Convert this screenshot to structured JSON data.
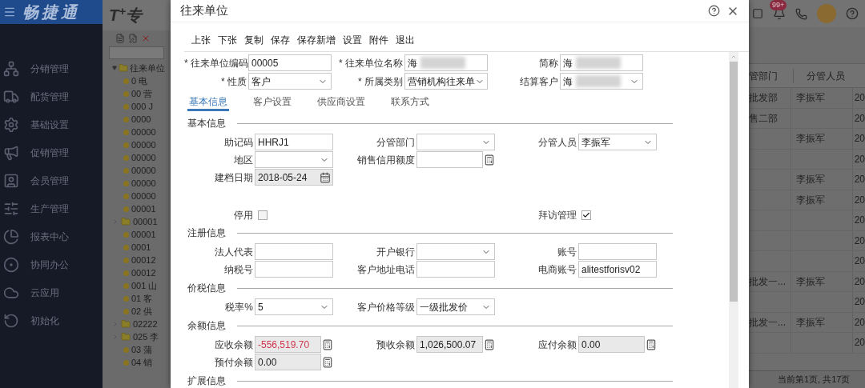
{
  "app": {
    "name": "畅捷通",
    "product": "T$^{+}$专",
    "sidebar": [
      {
        "label": "分销管理"
      },
      {
        "label": "配货管理"
      },
      {
        "label": "基础设置"
      },
      {
        "label": "促销管理"
      },
      {
        "label": "会员管理"
      },
      {
        "label": "生产管理"
      },
      {
        "label": "报表中心"
      },
      {
        "label": "协同办公"
      },
      {
        "label": "云应用"
      },
      {
        "label": "初始化"
      }
    ],
    "tree": {
      "label": "往来单位",
      "expanded": true,
      "children": [
        {
          "kind": "leaf",
          "label": "0 电"
        },
        {
          "kind": "leaf",
          "label": "00 营"
        },
        {
          "kind": "leaf",
          "label": "000 J"
        },
        {
          "kind": "leaf",
          "label": "0000"
        },
        {
          "kind": "leaf",
          "label": "00000"
        },
        {
          "kind": "leaf",
          "label": "00000"
        },
        {
          "kind": "leaf",
          "label": "00000"
        },
        {
          "kind": "leaf",
          "label": "00000"
        },
        {
          "kind": "leaf",
          "label": "00000"
        },
        {
          "kind": "leaf",
          "label": "00000"
        },
        {
          "kind": "leaf",
          "label": "00001"
        },
        {
          "kind": "folder",
          "label": "00001",
          "expanded": false
        },
        {
          "kind": "leaf",
          "label": "00001"
        },
        {
          "kind": "leaf",
          "label": "0001"
        },
        {
          "kind": "leaf",
          "label": "00012"
        },
        {
          "kind": "leaf",
          "label": "00012"
        },
        {
          "kind": "leaf",
          "label": "001 山"
        },
        {
          "kind": "leaf",
          "label": "01 客"
        },
        {
          "kind": "leaf",
          "label": "02 供"
        },
        {
          "kind": "folder",
          "label": "02222",
          "expanded": false
        },
        {
          "kind": "folder",
          "label": "025 李",
          "expanded": false
        },
        {
          "kind": "leaf",
          "label": "03 蒲"
        },
        {
          "kind": "leaf",
          "label": "04 销"
        }
      ]
    },
    "notifications": "99+",
    "table": {
      "columns": [
        "管部门",
        "分管人员"
      ],
      "rows": [
        {
          "dept": "批发部",
          "person": "李振军",
          "column_3": "20"
        },
        {
          "dept": "售二部",
          "person": "",
          "column_3": "20"
        },
        {
          "dept": "",
          "person": "李振军",
          "column_3": "20"
        },
        {
          "dept": "",
          "person": "",
          "column_3": "20"
        },
        {
          "dept": "",
          "person": "李振军",
          "column_3": "20"
        },
        {
          "dept": "",
          "person": "李振军",
          "column_3": "20"
        },
        {
          "dept": "",
          "person": "",
          "column_3": "20"
        },
        {
          "dept": "",
          "person": "",
          "column_3": "20"
        },
        {
          "dept": "",
          "person": "",
          "column_3": "20"
        },
        {
          "dept": "批发一...",
          "person": "李振军",
          "column_3": "20"
        },
        {
          "dept": "",
          "person": "",
          "column_3": "20"
        },
        {
          "dept": "批发一...",
          "person": "李振军",
          "column_3": "20"
        },
        {
          "dept": "",
          "person": "",
          "column_3": "20"
        }
      ]
    },
    "pager": "当前第1页, 共17页"
  },
  "dialog": {
    "title": "往来单位",
    "toolbar": [
      "上张",
      "下张",
      "复制",
      "保存",
      "保存新增",
      "设置",
      "附件",
      "退出"
    ],
    "header_rows": [
      [
        {
          "label": "* 往来单位编码",
          "kind": "text",
          "value": "00005"
        },
        {
          "label": "* 往来单位名称",
          "kind": "text",
          "value": "海",
          "blurred": true
        },
        {
          "label": "简称",
          "kind": "text",
          "value": "海",
          "blurred": true
        }
      ],
      [
        {
          "label": "* 性质",
          "kind": "select",
          "value": "客户"
        },
        {
          "label": "* 所属类别",
          "kind": "select",
          "value": "营销机构往来单"
        },
        {
          "label": "结算客户",
          "kind": "select",
          "value": "海",
          "blurred": true
        }
      ]
    ],
    "tabs": [
      {
        "label": "基本信息",
        "selected": true
      },
      {
        "label": "客户设置",
        "selected": false
      },
      {
        "label": "供应商设置",
        "selected": false
      },
      {
        "label": "联系方式",
        "selected": false
      }
    ],
    "sections": [
      {
        "title": "基本信息",
        "rows": [
          [
            {
              "label": "助记码",
              "kind": "text",
              "value": "HHRJ1"
            },
            {
              "label": "分管部门",
              "kind": "select"
            },
            {
              "label": "分管人员",
              "kind": "select",
              "value": "李振军"
            }
          ],
          [
            {
              "label": "地区",
              "kind": "select"
            },
            {
              "label": "销售信用额度",
              "kind": "calc"
            },
            null
          ],
          [
            {
              "label": "建档日期",
              "kind": "date",
              "value": "2018-05-24"
            },
            null,
            null
          ],
          [
            {
              "kind": "spacer"
            },
            null,
            null
          ],
          [
            {
              "label": "停用",
              "kind": "checkbox",
              "checked": false
            },
            null,
            {
              "label": "拜访管理",
              "kind": "checkbox",
              "checked": true
            }
          ]
        ]
      },
      {
        "title": "注册信息",
        "rows": [
          [
            {
              "label": "法人代表",
              "kind": "text"
            },
            {
              "label": "开户银行",
              "kind": "select"
            },
            {
              "label": "账号",
              "kind": "text"
            }
          ],
          [
            {
              "label": "纳税号",
              "kind": "text"
            },
            {
              "label": "客户地址电话",
              "kind": "text"
            },
            {
              "label": "电商账号",
              "kind": "text",
              "value": "alitestforisv02"
            }
          ]
        ]
      },
      {
        "title": "价税信息",
        "rows": [
          [
            {
              "label": "税率%",
              "kind": "select",
              "value": "5"
            },
            {
              "label": "客户价格等级",
              "kind": "select",
              "value": "一级批发价"
            },
            null
          ]
        ]
      },
      {
        "title": "余额信息",
        "rows": [
          [
            {
              "label": "应收余额",
              "kind": "calc",
              "readonly": true,
              "negative": true,
              "value": "-556,519.70"
            },
            {
              "label": "预收余额",
              "kind": "calc",
              "readonly": true,
              "value": "1,026,500.07"
            },
            {
              "label": "应付余额",
              "kind": "calc",
              "readonly": true,
              "value": "0.00"
            }
          ],
          [
            {
              "label": "预付余额",
              "kind": "calc",
              "readonly": true,
              "value": "0.00"
            },
            null,
            null
          ]
        ]
      },
      {
        "title": "扩展信息"
      }
    ]
  }
}
